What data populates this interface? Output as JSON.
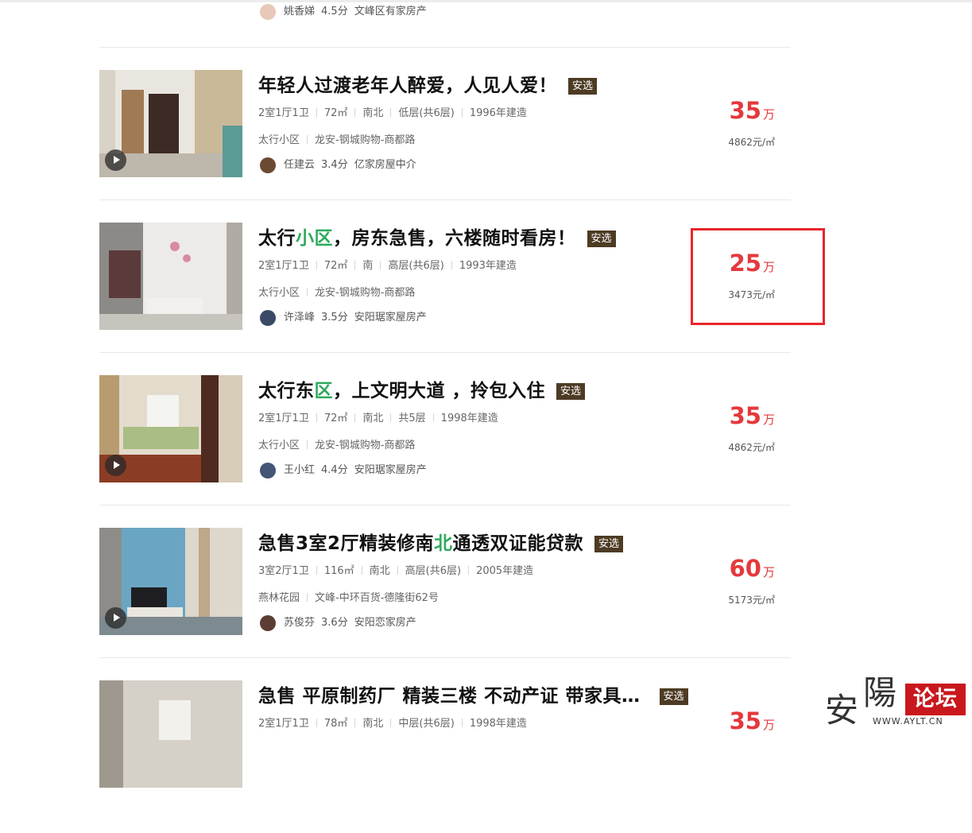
{
  "listings": [
    {
      "title_parts": [
        "",
        ""
      ],
      "badge": "",
      "meta": [],
      "community": "",
      "area": "",
      "agent": "姚香娣",
      "score": "4.5分",
      "agency": "文峰区有家房产",
      "price": "",
      "price_unit": "",
      "unit_price": ""
    },
    {
      "title_parts": [
        "年轻人过渡老年人醉爱，人见人爱！",
        "",
        ""
      ],
      "badge": "安选",
      "meta": [
        "2室1厅1卫",
        "72㎡",
        "南北",
        "低层(共6层)",
        "1996年建造"
      ],
      "community": "太行小区",
      "area": "龙安-钢城购物-商都路",
      "agent": "任建云",
      "score": "3.4分",
      "agency": "亿家房屋中介",
      "price": "35",
      "price_unit": "万",
      "unit_price": "4862元/㎡"
    },
    {
      "title_parts": [
        "太行",
        "小区",
        "，房东急售，六楼随时看房！"
      ],
      "badge": "安选",
      "meta": [
        "2室1厅1卫",
        "72㎡",
        "南",
        "高层(共6层)",
        "1993年建造"
      ],
      "community": "太行小区",
      "area": "龙安-钢城购物-商都路",
      "agent": "许泽峰",
      "score": "3.5分",
      "agency": "安阳琚家屋房产",
      "price": "25",
      "price_unit": "万",
      "unit_price": "3473元/㎡"
    },
    {
      "title_parts": [
        "太行东",
        "区",
        "，上文明大道 ，拎包入住"
      ],
      "badge": "安选",
      "meta": [
        "2室1厅1卫",
        "72㎡",
        "南北",
        "共5层",
        "1998年建造"
      ],
      "community": "太行小区",
      "area": "龙安-钢城购物-商都路",
      "agent": "王小红",
      "score": "4.4分",
      "agency": "安阳琚家屋房产",
      "price": "35",
      "price_unit": "万",
      "unit_price": "4862元/㎡"
    },
    {
      "title_parts": [
        "急售3室2厅精装修南",
        "北",
        "通透双证能贷款"
      ],
      "badge": "安选",
      "meta": [
        "3室2厅1卫",
        "116㎡",
        "南北",
        "高层(共6层)",
        "2005年建造"
      ],
      "community": "燕林花园",
      "area": "文峰-中环百货-德隆街62号",
      "agent": "苏俊芬",
      "score": "3.6分",
      "agency": "安阳恋家房产",
      "price": "60",
      "price_unit": "万",
      "unit_price": "5173元/㎡"
    },
    {
      "title_parts": [
        "急售 平原制药厂 精装三楼 不动产证 带家具…",
        "",
        ""
      ],
      "badge": "安选",
      "meta": [
        "2室1厅1卫",
        "78㎡",
        "南北",
        "中层(共6层)",
        "1998年建造"
      ],
      "community": "",
      "area": "",
      "agent": "",
      "score": "",
      "agency": "",
      "price": "35",
      "price_unit": "万",
      "unit_price": ""
    }
  ],
  "watermark": {
    "char1": "安",
    "char2": "陽",
    "box": "论坛",
    "url": "WWW.AYLT.CN"
  },
  "colors": {
    "price": "#e4393c",
    "highlight": "#2faa5e",
    "badge": "#4d3b24",
    "redbox": "#e8262b"
  }
}
